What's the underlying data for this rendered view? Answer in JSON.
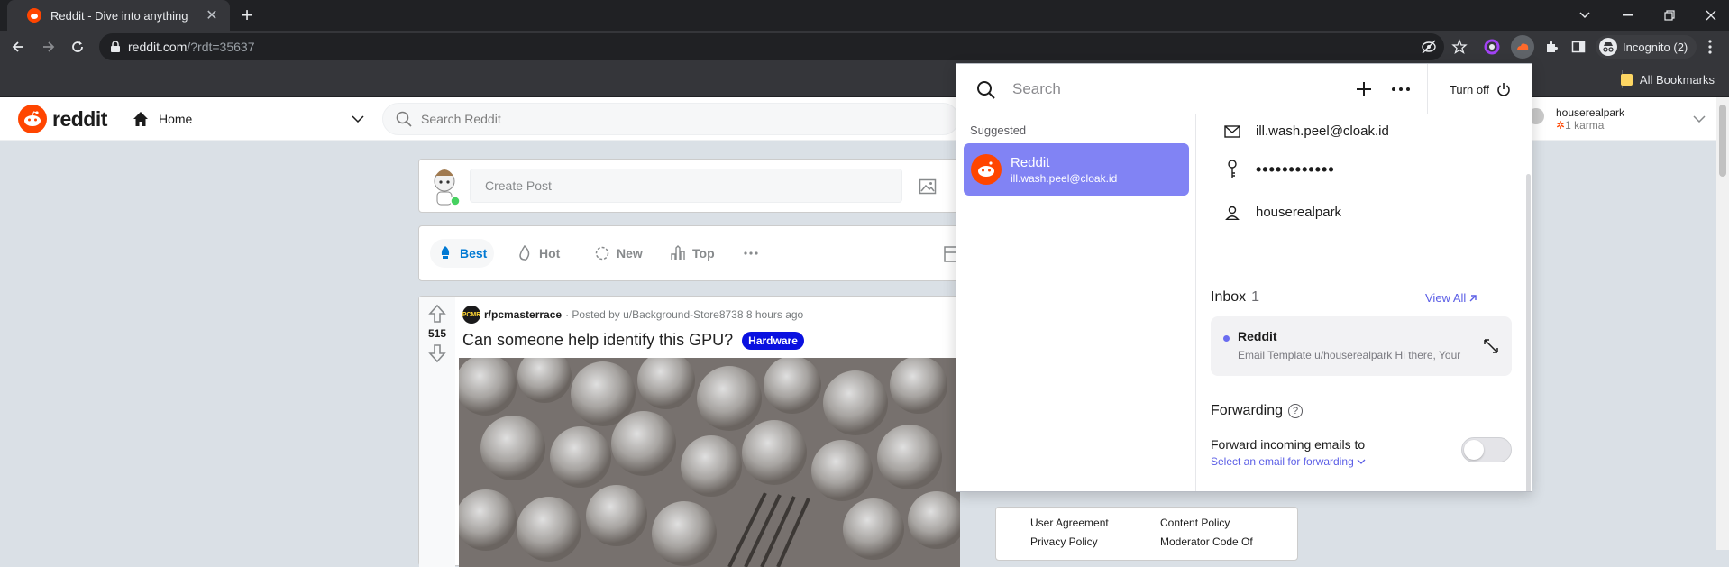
{
  "browser": {
    "tab_title": "Reddit - Dive into anything",
    "url_host": "reddit.com",
    "url_path": "/?rdt=35637",
    "incognito_label": "Incognito (2)",
    "bookmarks_label": "All Bookmarks",
    "new_tab_symbol": "+",
    "close_symbol": "✕"
  },
  "reddit": {
    "wordmark": "reddit",
    "home_label": "Home",
    "search_placeholder": "Search Reddit",
    "user_name": "houserealpark",
    "user_karma": "1 karma",
    "create_post_placeholder": "Create Post",
    "sort": [
      {
        "label": "Best"
      },
      {
        "label": "Hot"
      },
      {
        "label": "New"
      },
      {
        "label": "Top"
      }
    ],
    "post": {
      "subreddit": "r/pcmasterrace",
      "sub_icon_text": "PCMR",
      "meta": "· Posted by u/Background-Store8738 8 hours ago",
      "votes": "515",
      "title": "Can someone help identify this GPU?",
      "flair": "Hardware"
    },
    "footer_links": [
      "User Agreement",
      "Content Policy",
      "Privacy Policy",
      "Moderator Code Of"
    ]
  },
  "cloaked": {
    "search_placeholder": "Search",
    "turn_off_label": "Turn off",
    "suggested_label": "Suggested",
    "suggested_item": {
      "name": "Reddit",
      "email": "ill.wash.peel@cloak.id"
    },
    "identity": {
      "email": "ill.wash.peel@cloak.id",
      "password_masked": "••••••••••••",
      "username": "houserealpark"
    },
    "inbox": {
      "title": "Inbox",
      "count": "1",
      "view_all": "View All",
      "message": {
        "from": "Reddit",
        "preview": "Email Template u/houserealpark Hi there, Your"
      }
    },
    "forwarding": {
      "title": "Forwarding",
      "label": "Forward incoming emails to",
      "select_link": "Select an email for forwarding",
      "enabled": false
    }
  },
  "colors": {
    "reddit_orange": "#ff4500",
    "cloaked_accent": "#8183f4",
    "link_blue": "#0079d3",
    "flair_blue": "#0a11e0"
  }
}
